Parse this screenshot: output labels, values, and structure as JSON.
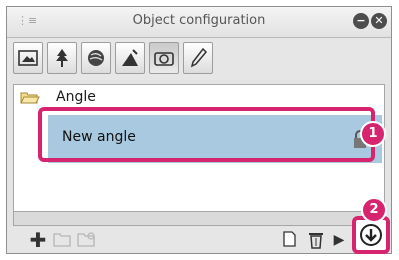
{
  "window": {
    "title": "Object configuration",
    "grip_icon": "panel-grip-icon",
    "minimize_icon": "collapse-circle-icon",
    "close_icon": "close-circle-icon"
  },
  "toolbar": {
    "tabs": [
      {
        "icon": "frame-icon",
        "active": false
      },
      {
        "icon": "tree-icon",
        "active": false
      },
      {
        "icon": "shading-icon",
        "active": false
      },
      {
        "icon": "light-icon",
        "active": false
      },
      {
        "icon": "camera-icon",
        "active": true
      },
      {
        "icon": "pen-icon",
        "active": false
      }
    ]
  },
  "list": {
    "folder": {
      "label": "Angle",
      "icon": "folder-open-icon"
    },
    "items": [
      {
        "label": "New angle",
        "icon": "lock-icon",
        "selected": true
      }
    ]
  },
  "bottom": {
    "left_icons": [
      "add-icon",
      "new-folder-icon",
      "folder-settings-icon"
    ],
    "right_icons": [
      "copy-icon",
      "delete-icon",
      "play-icon",
      "download-icon"
    ]
  },
  "annotations": {
    "badge1": "1",
    "badge2": "2"
  },
  "colors": {
    "highlight": "#d6246e",
    "selected_row": "#a9c9e0"
  }
}
